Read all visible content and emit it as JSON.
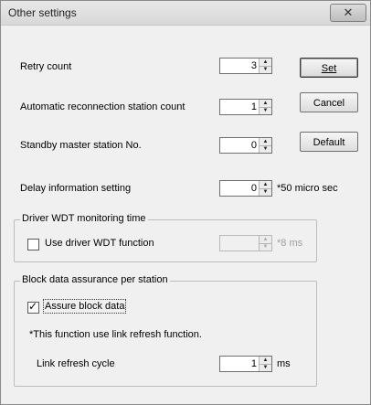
{
  "window": {
    "title": "Other settings",
    "close_glyph": "✕"
  },
  "fields": {
    "retry_count": {
      "label": "Retry count",
      "value": "3"
    },
    "auto_reconnect": {
      "label": "Automatic reconnection station count",
      "value": "1"
    },
    "standby_master": {
      "label": "Standby master station No.",
      "value": "0"
    },
    "delay_info": {
      "label": "Delay information setting",
      "value": "0",
      "unit": "*50 micro sec"
    }
  },
  "buttons": {
    "set": "Set",
    "cancel": "Cancel",
    "default": "Default"
  },
  "driver_wdt": {
    "group_title": "Driver WDT monitoring time",
    "checkbox_label": "Use driver WDT function",
    "checked": false,
    "value": "",
    "unit": "*8 ms"
  },
  "block_data": {
    "group_title": "Block data assurance per station",
    "checkbox_label": "Assure block data",
    "checked": true,
    "note": "*This function use link refresh function.",
    "refresh_label": "Link refresh cycle",
    "refresh_value": "1",
    "refresh_unit": "ms"
  },
  "icons": {
    "up": "up-arrow-icon",
    "down": "down-arrow-icon",
    "tick": "checkmark-icon"
  }
}
